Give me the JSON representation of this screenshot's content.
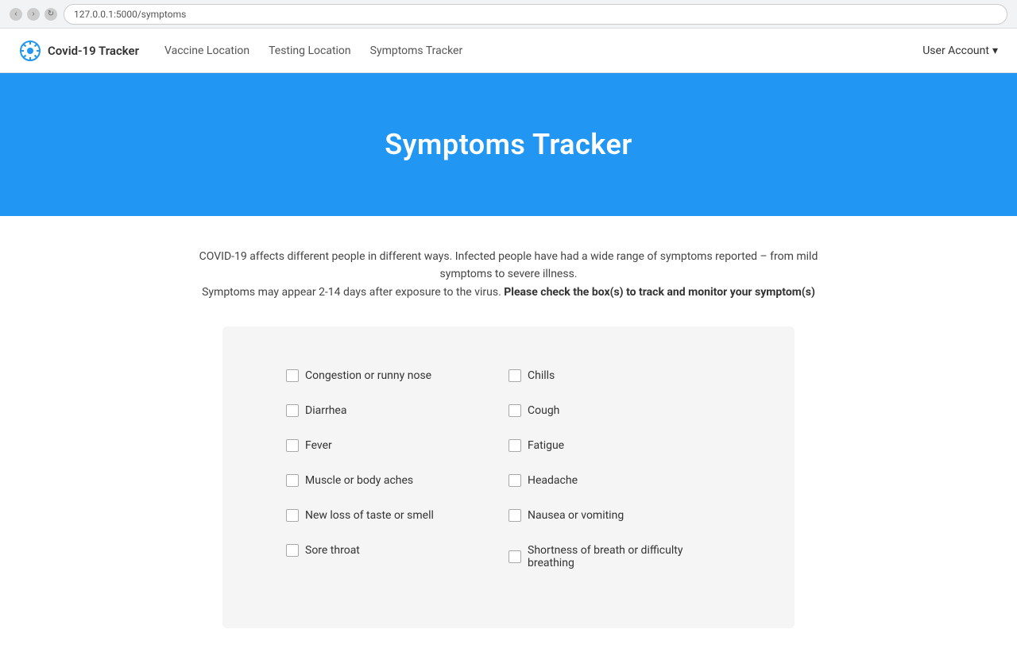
{
  "browser": {
    "url": "127.0.0.1:5000/symptoms"
  },
  "navbar": {
    "brand_label": "Covid-19 Tracker",
    "nav_items": [
      {
        "id": "vaccine-location",
        "label": "Vaccine Location"
      },
      {
        "id": "testing-location",
        "label": "Testing Location"
      },
      {
        "id": "symptoms-tracker",
        "label": "Symptoms Tracker"
      }
    ],
    "user_account_label": "User Account",
    "dropdown_symbol": "▾"
  },
  "hero": {
    "title": "Symptoms Tracker"
  },
  "description": {
    "line1": "COVID-19 affects different people in different ways. Infected people have had a wide range of symptoms reported – from mild symptoms to severe illness.",
    "line2_prefix": "Symptoms may appear 2-14 days after exposure to the virus.",
    "line2_bold": "Please check the box(s) to track and monitor your symptom(s)"
  },
  "symptoms": {
    "left_column": [
      {
        "id": "congestion",
        "label": "Congestion or runny nose"
      },
      {
        "id": "diarrhea",
        "label": "Diarrhea"
      },
      {
        "id": "fever",
        "label": "Fever"
      },
      {
        "id": "muscle-aches",
        "label": "Muscle or body aches"
      },
      {
        "id": "taste-smell",
        "label": "New loss of taste or smell"
      },
      {
        "id": "sore-throat",
        "label": "Sore throat"
      }
    ],
    "right_column": [
      {
        "id": "chills",
        "label": "Chills"
      },
      {
        "id": "cough",
        "label": "Cough"
      },
      {
        "id": "fatigue",
        "label": "Fatigue"
      },
      {
        "id": "headache",
        "label": "Headache"
      },
      {
        "id": "nausea",
        "label": "Nausea or vomiting"
      },
      {
        "id": "shortness-breath",
        "label": "Shortness of breath or difficulty breathing"
      }
    ]
  },
  "colors": {
    "hero_bg": "#2196F3",
    "nav_bg": "#ffffff",
    "card_bg": "#f5f5f5"
  }
}
